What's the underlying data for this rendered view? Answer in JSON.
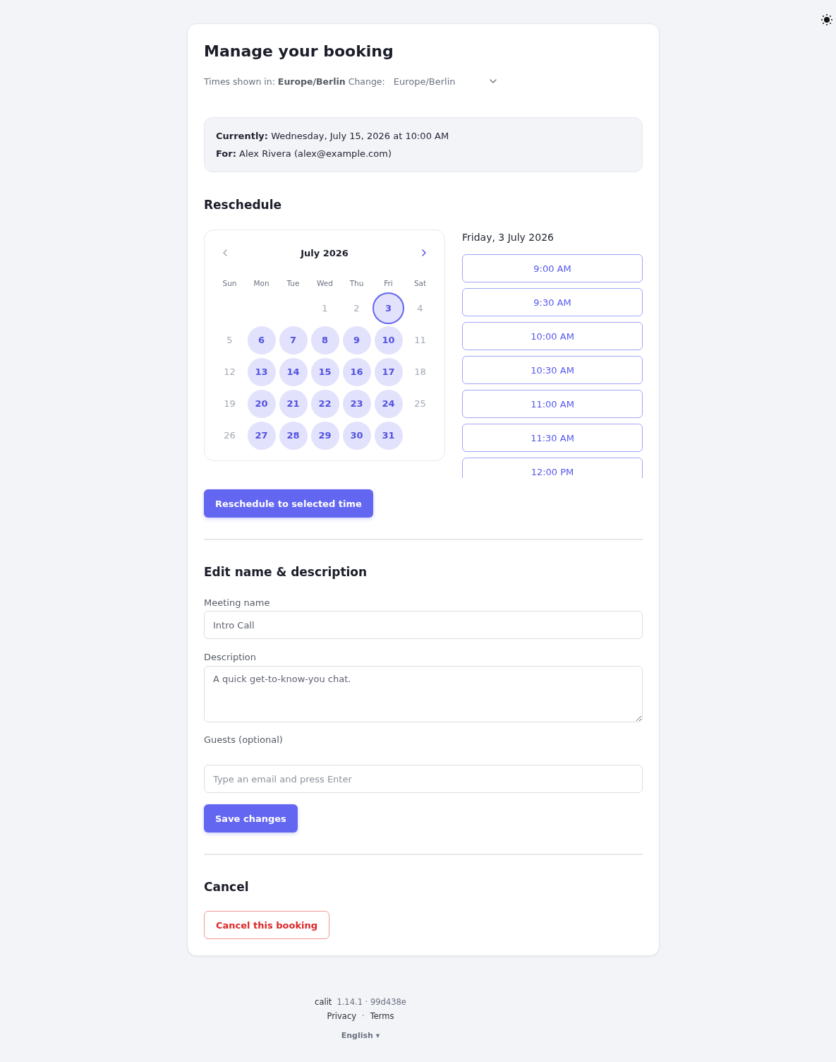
{
  "page": {
    "title": "Manage your booking",
    "timezone_note": "Times shown in: **Europe/Berlin** Change:",
    "timezone_select": {
      "value": "Europe/Berlin"
    }
  },
  "booking": {
    "current": "**Currently:** Wednesday, July 15, 2026 at 10:00 AM",
    "for": "**For:** Alex Rivera (alex@example.com)"
  },
  "reschedule": {
    "heading": "Reschedule",
    "calendar": {
      "month": "July 2026",
      "prev": {
        "disabled": true
      },
      "next": {
        "disabled": false
      },
      "weekdays": [
        "Sun",
        "Mon",
        "Tue",
        "Wed",
        "Thu",
        "Fri",
        "Sat"
      ],
      "weeks": [
        [
          {
            "day": "1",
            "available": false,
            "selected": false
          },
          {
            "day": "2",
            "available": false,
            "selected": false
          },
          {
            "day": "3",
            "available": true,
            "selected": true
          },
          {
            "day": "4",
            "available": false,
            "selected": false
          }
        ],
        [
          {
            "day": "5",
            "available": false,
            "selected": false
          },
          {
            "day": "6",
            "available": true,
            "selected": false
          },
          {
            "day": "7",
            "available": true,
            "selected": false
          },
          {
            "day": "8",
            "available": true,
            "selected": false
          },
          {
            "day": "9",
            "available": true,
            "selected": false
          },
          {
            "day": "10",
            "available": true,
            "selected": false
          },
          {
            "day": "11",
            "available": false,
            "selected": false
          }
        ],
        [
          {
            "day": "12",
            "available": false,
            "selected": false
          },
          {
            "day": "13",
            "available": true,
            "selected": false
          },
          {
            "day": "14",
            "available": true,
            "selected": false
          },
          {
            "day": "15",
            "available": true,
            "selected": false
          },
          {
            "day": "16",
            "available": true,
            "selected": false
          },
          {
            "day": "17",
            "available": true,
            "selected": false
          },
          {
            "day": "18",
            "available": false,
            "selected": false
          }
        ],
        [
          {
            "day": "19",
            "available": false,
            "selected": false
          },
          {
            "day": "20",
            "available": true,
            "selected": false
          },
          {
            "day": "21",
            "available": true,
            "selected": false
          },
          {
            "day": "22",
            "available": true,
            "selected": false
          },
          {
            "day": "23",
            "available": true,
            "selected": false
          },
          {
            "day": "24",
            "available": true,
            "selected": false
          },
          {
            "day": "25",
            "available": false,
            "selected": false
          }
        ],
        [
          {
            "day": "26",
            "available": false,
            "selected": false
          },
          {
            "day": "27",
            "available": true,
            "selected": false
          },
          {
            "day": "28",
            "available": true,
            "selected": false
          },
          {
            "day": "29",
            "available": true,
            "selected": false
          },
          {
            "day": "30",
            "available": true,
            "selected": false
          },
          {
            "day": "31",
            "available": true,
            "selected": false
          }
        ]
      ]
    },
    "date_heading": "Friday, 3 July 2026",
    "time_slots": [
      {
        "label": "9:00 AM",
        "selected": false
      },
      {
        "label": "9:30 AM",
        "selected": false
      },
      {
        "label": "10:00 AM",
        "selected": false
      },
      {
        "label": "10:30 AM",
        "selected": false
      },
      {
        "label": "11:00 AM",
        "selected": false
      },
      {
        "label": "11:30 AM",
        "selected": false
      },
      {
        "label": "12:00 PM",
        "selected": false
      }
    ],
    "submit": "Reschedule to selected time"
  },
  "edit": {
    "heading": "Edit name & description",
    "fields": [
      {
        "kind": "text",
        "label": "Meeting name",
        "value": "Intro Call"
      },
      {
        "kind": "textarea",
        "label": "Description",
        "value": "A quick get-to-know-you chat."
      },
      {
        "kind": "tags",
        "label": "Guests (optional)",
        "placeholder": "Type an email and press Enter"
      }
    ],
    "submit": "Save changes"
  },
  "cancel": {
    "heading": "Cancel",
    "button": "Cancel this booking"
  },
  "footer": {
    "app_name": "calit",
    "version": "1.14.1 · 99d438e",
    "links": [
      "Privacy",
      "Terms"
    ],
    "separator": "·",
    "language": "English ▾"
  }
}
